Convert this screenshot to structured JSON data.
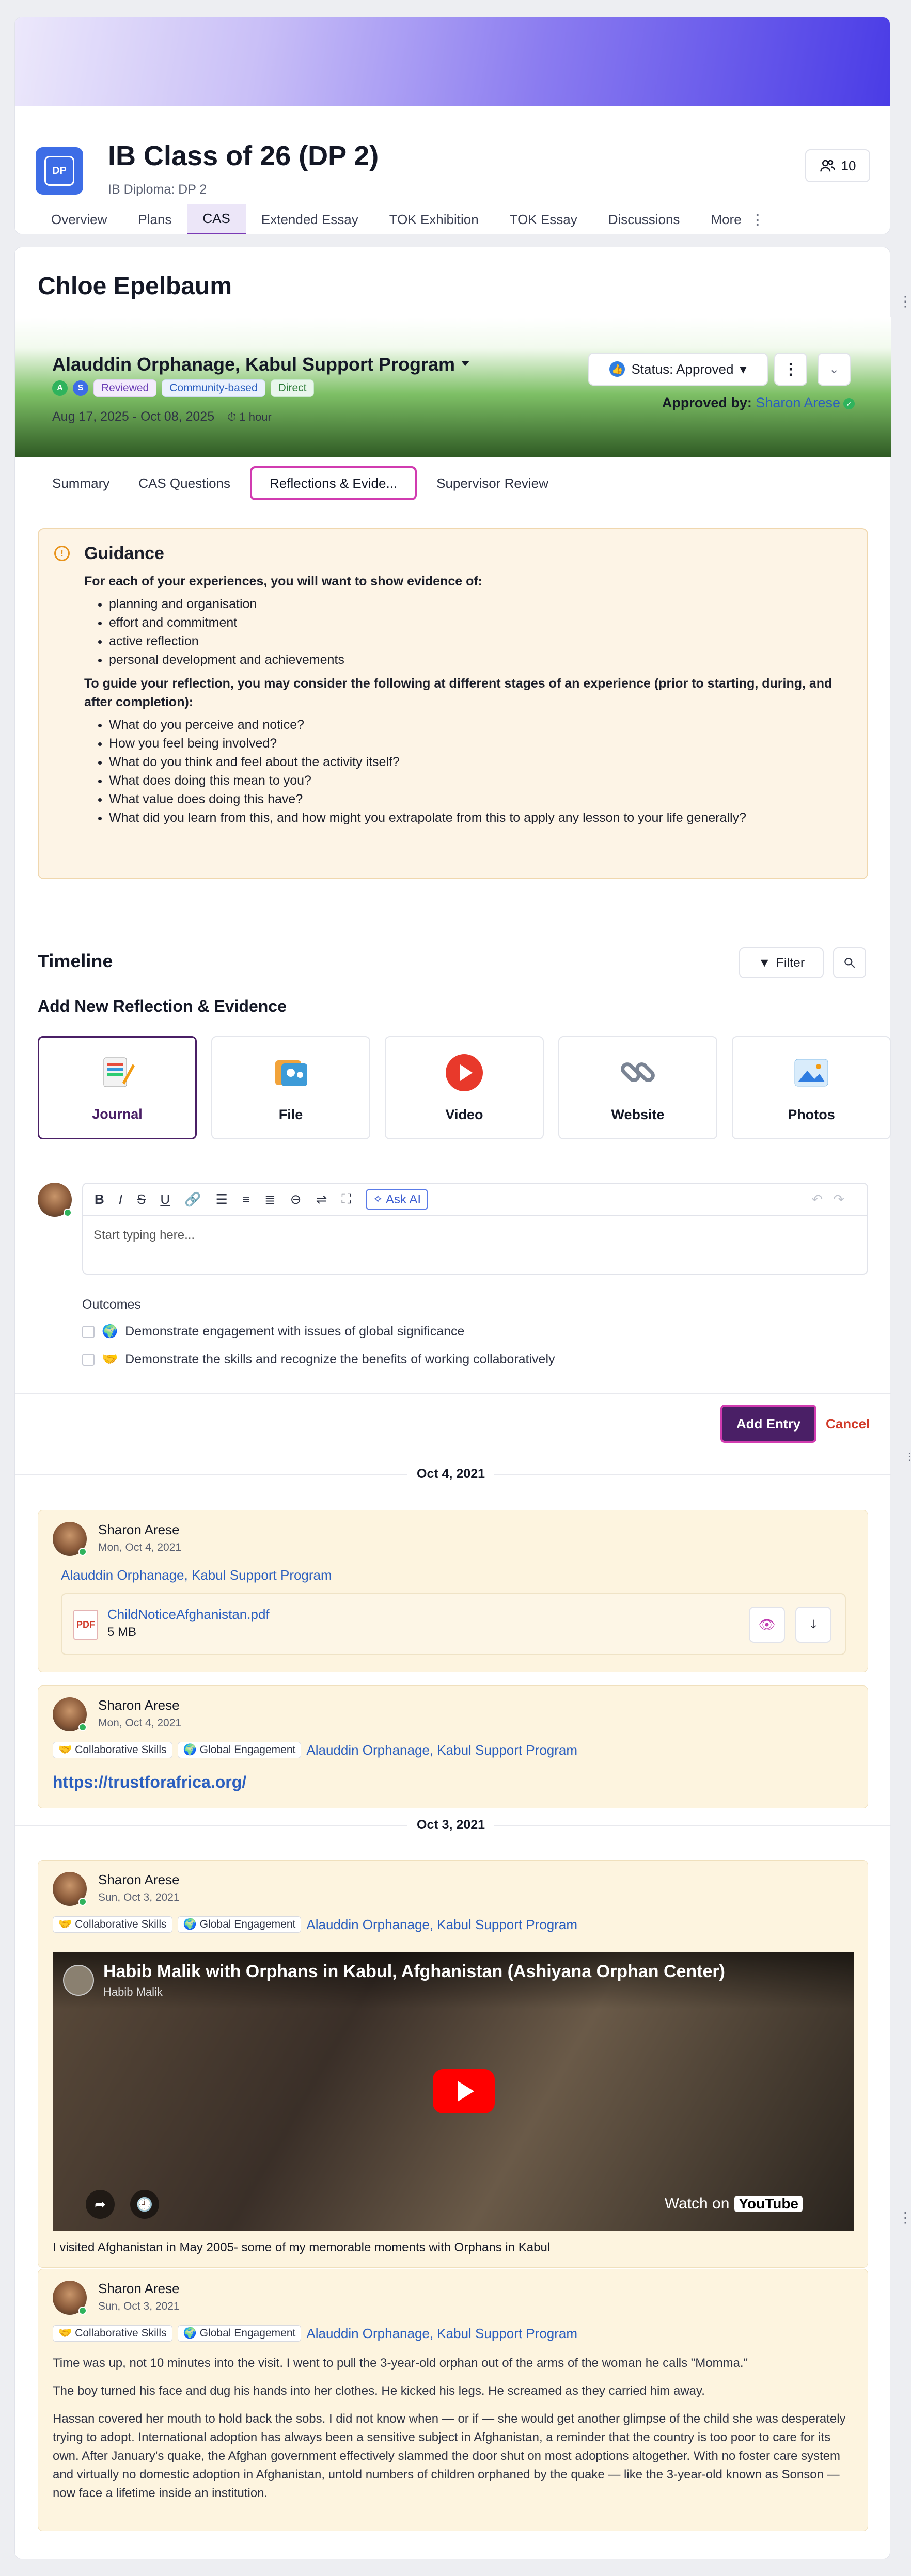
{
  "course": {
    "icon_text": "DP",
    "title": "IB Class of 26 (DP 2)",
    "subtitle": "IB Diploma: DP 2",
    "members_count": "10",
    "tabs": [
      "Overview",
      "Plans",
      "CAS",
      "Extended Essay",
      "TOK Exhibition",
      "TOK Essay",
      "Discussions",
      "More"
    ],
    "active_tab": "CAS"
  },
  "student": {
    "name": "Chloe Epelbaum"
  },
  "experience": {
    "title": "Alauddin Orphanage, Kabul Support Program",
    "avatars": [
      "A",
      "S"
    ],
    "tags": [
      "Reviewed",
      "Community-based",
      "Direct"
    ],
    "dates": "Aug 17, 2025 - Oct 08, 2025",
    "duration": "1 hour",
    "status_label": "Status: Approved",
    "approved_by_label": "Approved by:",
    "approver": "Sharon Arese"
  },
  "subtabs": [
    "Summary",
    "CAS Questions",
    "Reflections & Evide...",
    "Supervisor Review"
  ],
  "active_subtab": "Reflections & Evide...",
  "guidance": {
    "title": "Guidance",
    "intro1": "For each of your experiences, you will want to show evidence of:",
    "list1": [
      "planning and organisation",
      "effort and commitment",
      "active reflection",
      "personal development and achievements"
    ],
    "intro2": "To guide your reflection, you may consider the following at different stages of an experience (prior to starting, during, and after completion):",
    "list2": [
      "What do you perceive and notice?",
      "How you feel being involved?",
      "What do you think and feel about the activity itself?",
      "What does doing this mean to you?",
      "What value does doing this have?",
      "What did you learn from this, and how might you extrapolate from this to apply any lesson to your life generally?"
    ]
  },
  "timeline": {
    "title": "Timeline",
    "filter_label": "Filter",
    "add_title": "Add New Reflection & Evidence",
    "types": [
      "Journal",
      "File",
      "Video",
      "Website",
      "Photos"
    ],
    "active_type": "Journal"
  },
  "editor": {
    "ask_ai": "Ask AI",
    "placeholder": "Start typing here...",
    "outcomes_label": "Outcomes",
    "outcomes": [
      "Demonstrate engagement with issues of global significance",
      "Demonstrate the skills and recognize the benefits of working collaboratively"
    ],
    "add_button": "Add Entry",
    "cancel_button": "Cancel"
  },
  "dates": [
    "Oct 4, 2021",
    "Oct 3, 2021"
  ],
  "entries": [
    {
      "author": "Sharon Arese",
      "date": "Mon, Oct 4, 2021",
      "link": "Alauddin Orphanage, Kabul Support Program",
      "file_name": "ChildNoticeAfghanistan.pdf",
      "file_size": "5 MB"
    },
    {
      "author": "Sharon Arese",
      "date": "Mon, Oct 4, 2021",
      "chips": [
        "Collaborative Skills",
        "Global Engagement"
      ],
      "link": "Alauddin Orphanage, Kabul Support Program",
      "url": "https://trustforafrica.org/"
    },
    {
      "author": "Sharon Arese",
      "date": "Sun, Oct 3, 2021",
      "chips": [
        "Collaborative Skills",
        "Global Engagement"
      ],
      "link": "Alauddin Orphanage, Kabul Support Program",
      "video_title": "Habib Malik with Orphans in Kabul, Afghanistan (Ashiyana Orphan Center)",
      "video_author": "Habib Malik",
      "watch_on": "Watch on",
      "youtube": "YouTube",
      "caption": "I visited Afghanistan in May 2005- some of my memorable moments with Orphans in Kabul"
    },
    {
      "author": "Sharon Arese",
      "date": "Sun, Oct 3, 2021",
      "chips": [
        "Collaborative Skills",
        "Global Engagement"
      ],
      "link": "Alauddin Orphanage, Kabul Support Program",
      "paragraphs": [
        "Time was up, not 10 minutes into the visit. I went to pull the 3-year-old orphan out of the arms of the woman he calls \"Momma.\"",
        "The boy turned his face and dug his hands into her clothes. He kicked his legs. He screamed as they carried him away.",
        "Hassan covered her mouth to hold back the sobs. I did not know when — or if — she would get another glimpse of the child she was desperately trying to adopt. International adoption has always been a sensitive subject in Afghanistan, a reminder that the country is too poor to care for its own. After January's quake, the Afghan government effectively slammed the door shut on most adoptions altogether. With no foster care system and virtually no domestic adoption in Afghanistan, untold numbers of children orphaned by the quake — like the 3-year-old known as Sonson — now face a lifetime inside an institution."
      ]
    }
  ],
  "colors": {
    "accent": "#4a1f66",
    "highlight": "#d13bb0",
    "link": "#2b5fbf",
    "banner_start": "#ece8fb",
    "banner_end": "#4a3ce6"
  }
}
